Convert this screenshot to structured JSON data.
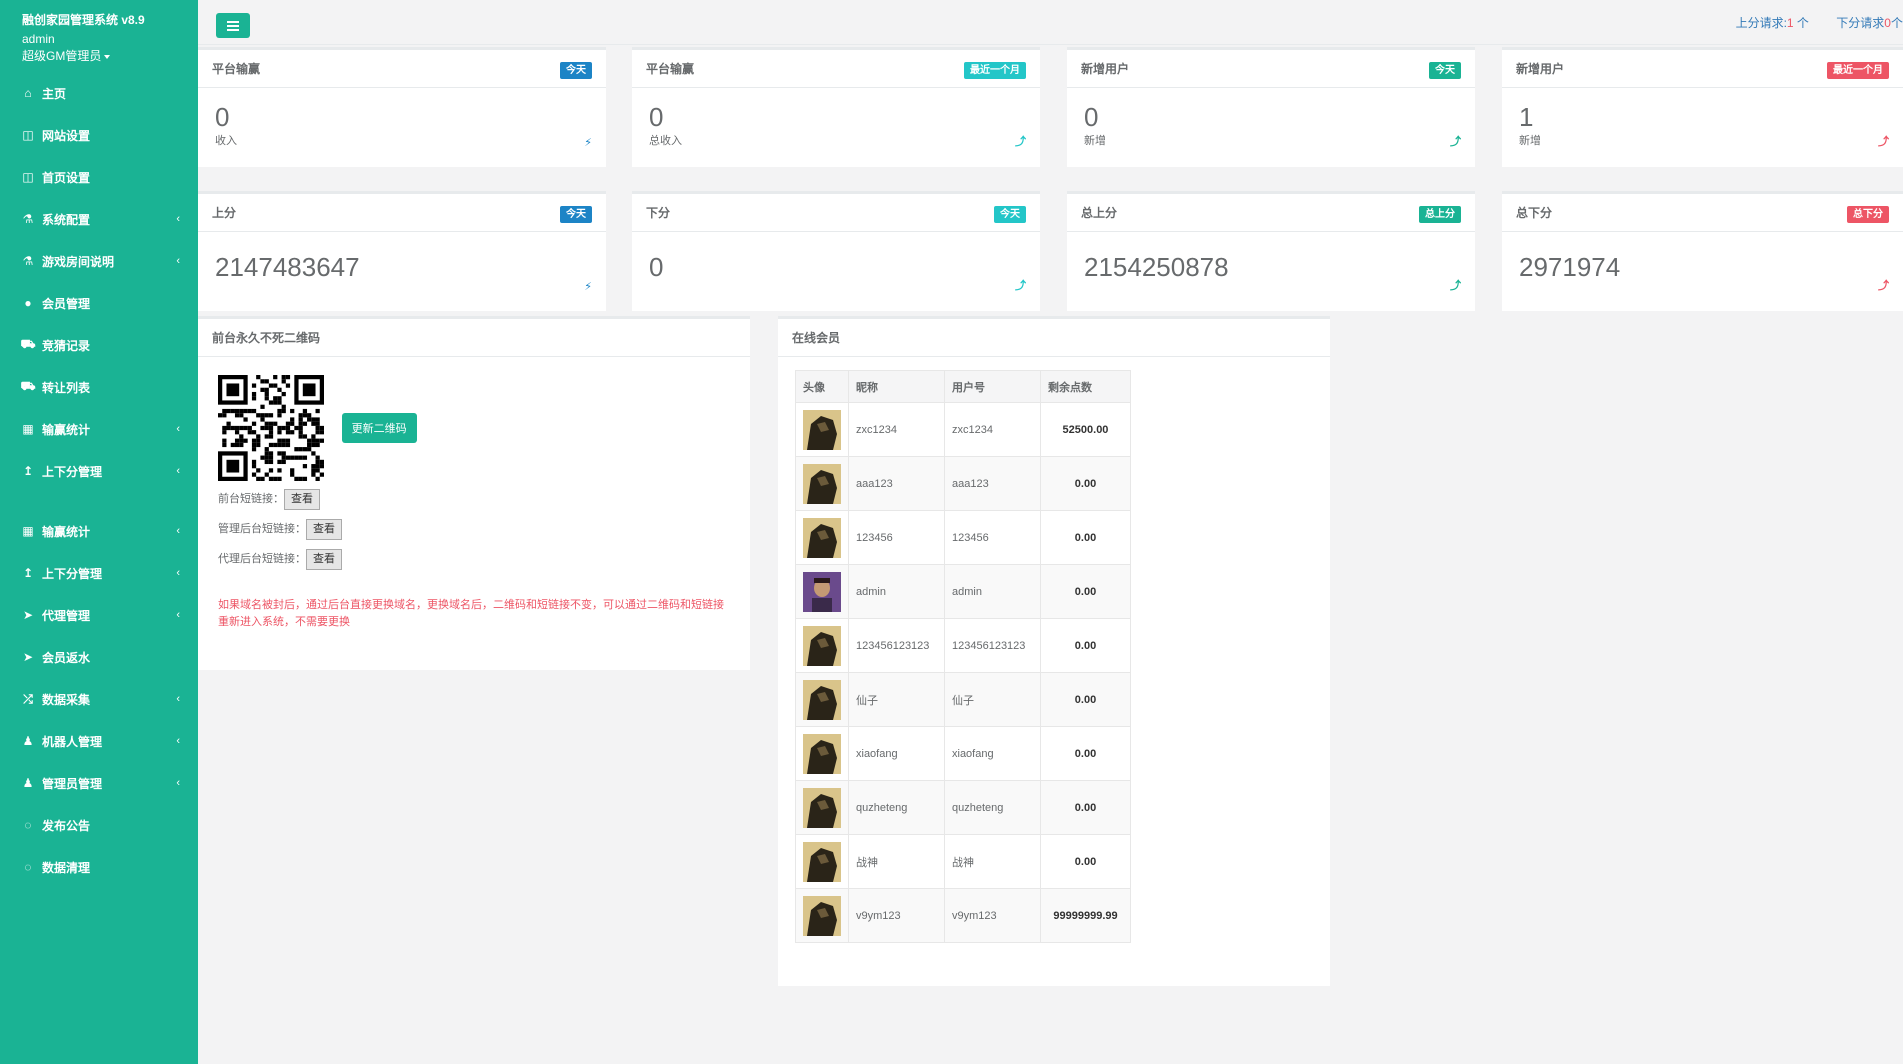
{
  "sidebar": {
    "title": "融创家园管理系统 v8.9",
    "user": "admin",
    "role": "超级GM管理员",
    "items": [
      {
        "label": "主页",
        "icon": "home-icon",
        "arrow": false
      },
      {
        "label": "网站设置",
        "icon": "columns-icon",
        "arrow": false
      },
      {
        "label": "首页设置",
        "icon": "columns-icon",
        "arrow": false
      },
      {
        "label": "系统配置",
        "icon": "flask-icon",
        "arrow": true
      },
      {
        "label": "游戏房间说明",
        "icon": "flask-icon",
        "arrow": true
      },
      {
        "label": "会员管理",
        "icon": "user-icon",
        "arrow": false
      },
      {
        "label": "竞猜记录",
        "icon": "car-icon",
        "arrow": false
      },
      {
        "label": "转让列表",
        "icon": "car-icon",
        "arrow": false
      },
      {
        "label": "输赢统计",
        "icon": "bar-chart-icon",
        "arrow": true
      },
      {
        "label": "上下分管理",
        "icon": "level-up-icon",
        "arrow": true
      },
      {
        "label": "输赢统计",
        "icon": "bar-chart-icon",
        "arrow": true
      },
      {
        "label": "上下分管理",
        "icon": "level-up-icon",
        "arrow": true
      },
      {
        "label": "代理管理",
        "icon": "paper-plane-icon",
        "arrow": true
      },
      {
        "label": "会员返水",
        "icon": "paper-plane-icon",
        "arrow": false
      },
      {
        "label": "数据采集",
        "icon": "random-icon",
        "arrow": true
      },
      {
        "label": "机器人管理",
        "icon": "male-icon",
        "arrow": true
      },
      {
        "label": "管理员管理",
        "icon": "male-icon",
        "arrow": true
      },
      {
        "label": "发布公告",
        "icon": "comment-icon",
        "arrow": false
      },
      {
        "label": "数据清理",
        "icon": "comment-icon",
        "arrow": false
      }
    ]
  },
  "topbar": {
    "up_label": "上分请求:",
    "up_count": "1",
    "up_unit": " 个",
    "down_label": "下分请求",
    "down_count": "0",
    "down_unit": "个"
  },
  "stats": [
    {
      "title": "平台输赢",
      "badge": "今天",
      "badge_color": "blue",
      "value": "0",
      "sub": "收入",
      "icon": "⚡",
      "icon_color": "blue"
    },
    {
      "title": "平台输赢",
      "badge": "最近一个月",
      "badge_color": "cyan",
      "value": "0",
      "sub": "总收入",
      "icon": "⤴",
      "icon_color": "cyan"
    },
    {
      "title": "新增用户",
      "badge": "今天",
      "badge_color": "green",
      "value": "0",
      "sub": "新增",
      "icon": "⤴",
      "icon_color": "green"
    },
    {
      "title": "新增用户",
      "badge": "最近一个月",
      "badge_color": "red",
      "value": "1",
      "sub": "新增",
      "icon": "⤴",
      "icon_color": "red"
    },
    {
      "title": "上分",
      "badge": "今天",
      "badge_color": "blue",
      "value": "2147483647",
      "sub": "",
      "icon": "⚡",
      "icon_color": "blue"
    },
    {
      "title": "下分",
      "badge": "今天",
      "badge_color": "cyan",
      "value": "0",
      "sub": "",
      "icon": "⤴",
      "icon_color": "cyan"
    },
    {
      "title": "总上分",
      "badge": "总上分",
      "badge_color": "green",
      "value": "2154250878",
      "sub": "",
      "icon": "⤴",
      "icon_color": "green"
    },
    {
      "title": "总下分",
      "badge": "总下分",
      "badge_color": "red",
      "value": "2971974",
      "sub": "",
      "icon": "⤴",
      "icon_color": "red"
    }
  ],
  "qr_panel": {
    "title": "前台永久不死二维码",
    "update_button": "更新二维码",
    "links": [
      {
        "label": "前台短链接：",
        "button": "查看"
      },
      {
        "label": "管理后台短链接：",
        "button": "查看"
      },
      {
        "label": "代理后台短链接：",
        "button": "查看"
      }
    ],
    "warning": "如果域名被封后，通过后台直接更换域名，更换域名后，二维码和短链接不变，可以通过二维码和短链接重新进入系统，不需要更换"
  },
  "online_panel": {
    "title": "在线会员",
    "columns": [
      "头像",
      "昵称",
      "用户号",
      "剩余点数"
    ],
    "rows": [
      {
        "nickname": "zxc1234",
        "user": "zxc1234",
        "points": "52500.00",
        "avatar": "dark"
      },
      {
        "nickname": "aaa123",
        "user": "aaa123",
        "points": "0.00",
        "avatar": "dark"
      },
      {
        "nickname": "123456",
        "user": "123456",
        "points": "0.00",
        "avatar": "dark"
      },
      {
        "nickname": "admin",
        "user": "admin",
        "points": "0.00",
        "avatar": "purple"
      },
      {
        "nickname": "123456123123",
        "user": "123456123123",
        "points": "0.00",
        "avatar": "dark"
      },
      {
        "nickname": "仙子",
        "user": "仙子",
        "points": "0.00",
        "avatar": "dark"
      },
      {
        "nickname": "xiaofang",
        "user": "xiaofang",
        "points": "0.00",
        "avatar": "dark"
      },
      {
        "nickname": "quzheteng",
        "user": "quzheteng",
        "points": "0.00",
        "avatar": "dark"
      },
      {
        "nickname": "战神",
        "user": "战神",
        "points": "0.00",
        "avatar": "dark"
      },
      {
        "nickname": "v9ym123",
        "user": "v9ym123",
        "points": "99999999.99",
        "avatar": "dark"
      }
    ]
  }
}
